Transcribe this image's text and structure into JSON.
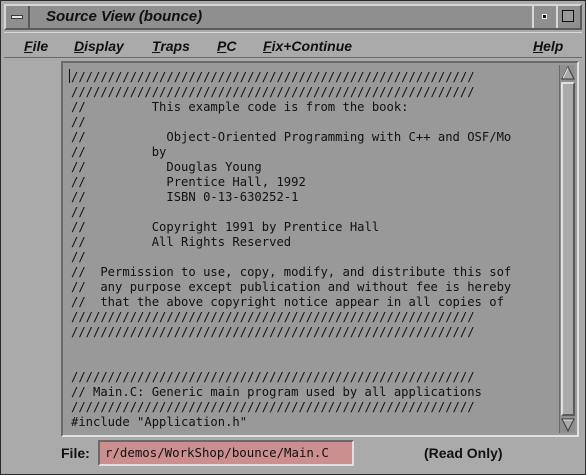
{
  "window": {
    "title": "Source View (bounce)"
  },
  "menu": {
    "items": [
      {
        "label": "File",
        "mnemonic": "F",
        "rest": "ile"
      },
      {
        "label": "Display",
        "mnemonic": "D",
        "rest": "isplay"
      },
      {
        "label": "Traps",
        "mnemonic": "T",
        "rest": "raps"
      },
      {
        "label": "PC",
        "mnemonic": "P",
        "rest": "C"
      },
      {
        "label": "Fix+Continue",
        "mnemonic": "F",
        "rest": "ix+Continue"
      },
      {
        "label": "Help",
        "mnemonic": "H",
        "rest": "elp"
      }
    ]
  },
  "code": {
    "lines": [
      "///////////////////////////////////////////////////////",
      "///////////////////////////////////////////////////////",
      "//         This example code is from the book:",
      "//",
      "//           Object-Oriented Programming with C++ and OSF/Mo",
      "//         by",
      "//           Douglas Young",
      "//           Prentice Hall, 1992",
      "//           ISBN 0-13-630252-1",
      "//",
      "//         Copyright 1991 by Prentice Hall",
      "//         All Rights Reserved",
      "//",
      "//  Permission to use, copy, modify, and distribute this sof",
      "//  any purpose except publication and without fee is hereby",
      "//  that the above copyright notice appear in all copies of",
      "///////////////////////////////////////////////////////",
      "///////////////////////////////////////////////////////",
      "",
      "",
      "///////////////////////////////////////////////////////",
      "// Main.C: Generic main program used by all applications",
      "///////////////////////////////////////////////////////",
      "#include \"Application.h\""
    ]
  },
  "status": {
    "file_label": "File:",
    "file_path": "r/demos/WorkShop/bounce/Main.C",
    "mode": "(Read Only)"
  },
  "colors": {
    "window_bg": "#aaaaaa",
    "code_bg": "#999999",
    "file_field_bg": "#cc8f8f"
  }
}
